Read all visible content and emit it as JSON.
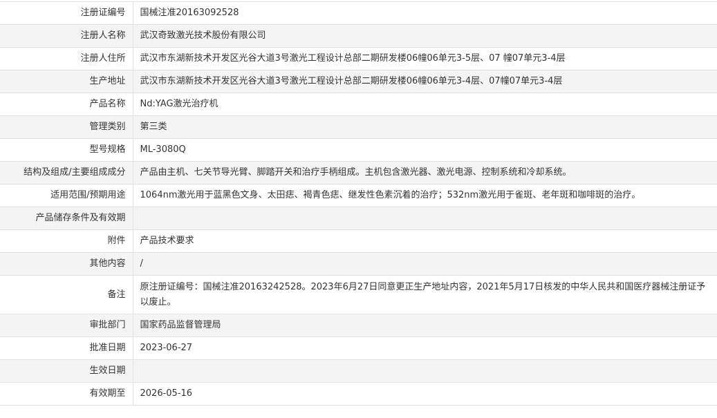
{
  "rows": [
    {
      "label": "注册证编号",
      "value": "国械注准20163092528"
    },
    {
      "label": "注册人名称",
      "value": "武汉奇致激光技术股份有限公司"
    },
    {
      "label": "注册人住所",
      "value": "武汉市东湖新技术开发区光谷大道3号激光工程设计总部二期研发楼06幢06单元3-5层、07 幢07单元3-4层"
    },
    {
      "label": "生产地址",
      "value": "武汉市东湖新技术开发区光谷大道3号激光工程设计总部二期研发楼06幢06单元3-4层、07幢07单元3-4层"
    },
    {
      "label": "产品名称",
      "value": "Nd:YAG激光治疗机"
    },
    {
      "label": "管理类别",
      "value": "第三类"
    },
    {
      "label": "型号规格",
      "value": "ML-3080Q"
    },
    {
      "label": "结构及组成/主要组成成分",
      "value": "产品由主机、七关节导光臂、脚踏开关和治疗手柄组成。主机包含激光器、激光电源、控制系统和冷却系统。"
    },
    {
      "label": "适用范围/预期用途",
      "value": "1064nm激光用于蓝黑色文身、太田痣、褐青色痣、继发性色素沉着的治疗；532nm激光用于雀斑、老年斑和咖啡斑的治疗。"
    },
    {
      "label": "产品储存条件及有效期",
      "value": ""
    },
    {
      "label": "附件",
      "value": "产品技术要求"
    },
    {
      "label": "其他内容",
      "value": "/"
    },
    {
      "label": "备注",
      "value": "原注册证编号：国械注准20163242528。2023年6月27日同意更正生产地址内容，2021年5月17日核发的中华人民共和国医疗器械注册证予以废止。"
    },
    {
      "label": "审批部门",
      "value": "国家药品监督管理局"
    },
    {
      "label": "批准日期",
      "value": "2023-06-27"
    },
    {
      "label": "生效日期",
      "value": ""
    },
    {
      "label": "有效期至",
      "value": "2026-05-16"
    }
  ]
}
